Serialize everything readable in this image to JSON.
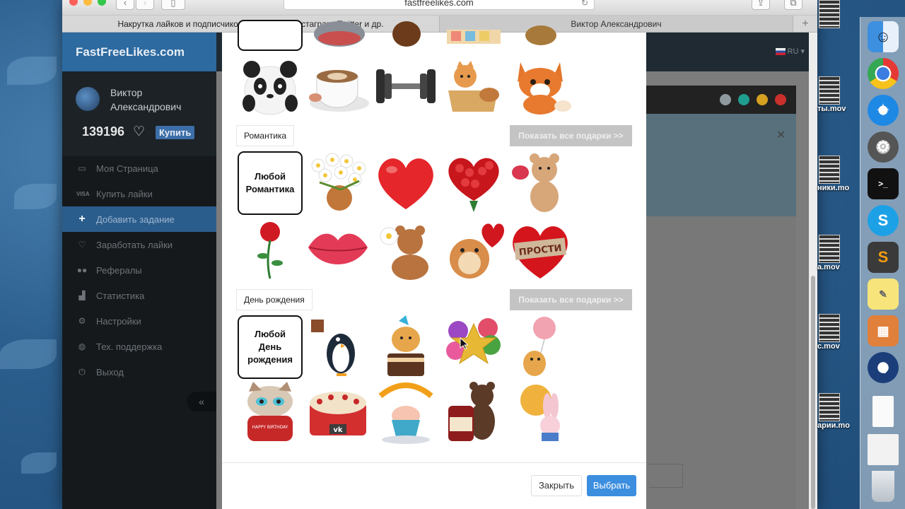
{
  "browser": {
    "url": "fastfreelikes.com",
    "tabs": [
      {
        "label": "Накрутка лайков и подписчиков ВКонтакте, Инстаграм, Twitter и др."
      },
      {
        "label": "Виктор Александрович"
      }
    ]
  },
  "site": {
    "brand": "FastFreeLikes.com",
    "user": {
      "name": "Виктор Александрович",
      "balance": "139196",
      "buy_label": "Купить"
    },
    "lang": "RU",
    "menu": [
      {
        "label": "Моя Страница",
        "icon": "laptop-icon"
      },
      {
        "label": "Купить лайки",
        "icon": "visa-card-icon"
      },
      {
        "label": "Добавить задание",
        "icon": "plus-icon"
      },
      {
        "label": "Заработать лайки",
        "icon": "heart-outline-icon"
      },
      {
        "label": "Рефералы",
        "icon": "users-icon"
      },
      {
        "label": "Статистика",
        "icon": "chart-icon"
      },
      {
        "label": "Настройки",
        "icon": "gears-icon"
      },
      {
        "label": "Тех. поддержка",
        "icon": "globe-icon"
      },
      {
        "label": "Выход",
        "icon": "power-icon"
      }
    ],
    "collapse_label": "«"
  },
  "modal": {
    "sections": [
      {
        "title": "Романтика",
        "show_all": "Показать все подарки >>",
        "any_label": "Любой Романтика"
      },
      {
        "title": "День рождения",
        "show_all": "Показать все подарки >>",
        "any_label": "Любой День рождения"
      }
    ],
    "gift_texts": {
      "prosti": "ПРОСТИ",
      "vk": "vk",
      "happy": "HAPPY BIRTHDAY"
    },
    "footer": {
      "close": "Закрыть",
      "select": "Выбрать"
    }
  },
  "desktop_files": [
    {
      "label": ""
    },
    {
      "label": "ты.mov"
    },
    {
      "label": "ники.mo"
    },
    {
      "label": "а.mov"
    },
    {
      "label": "с.mov"
    },
    {
      "label": "арии.mo"
    }
  ],
  "colors": {
    "accent": "#2c6aa0",
    "select_button": "#3c8edf",
    "show_all_button": "#c4c4c4"
  }
}
